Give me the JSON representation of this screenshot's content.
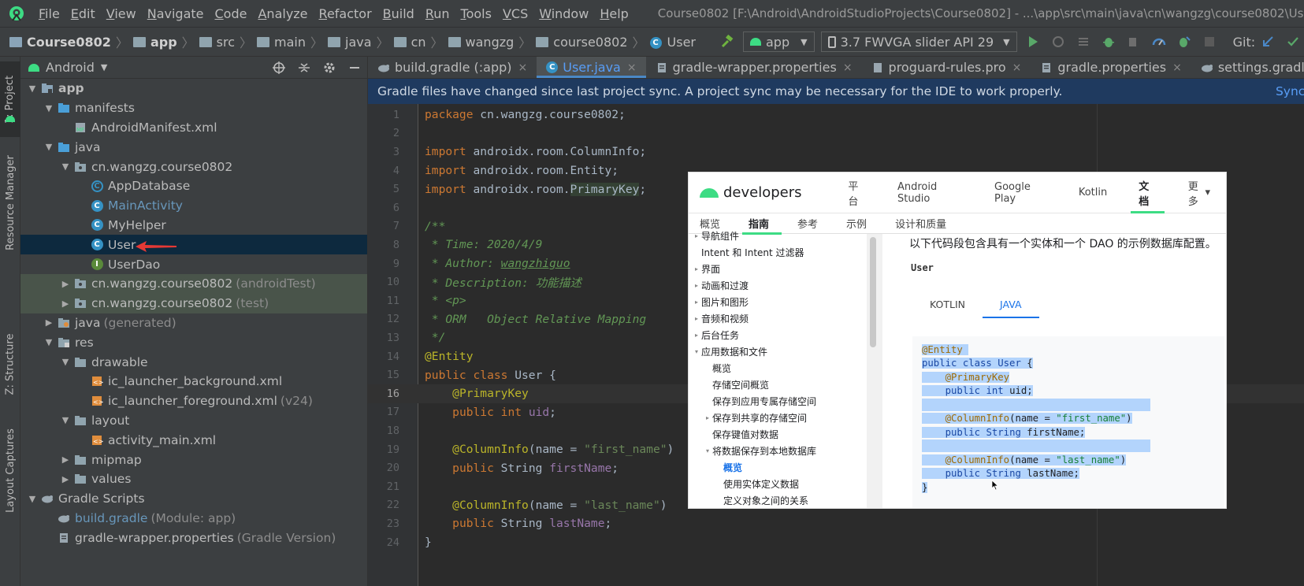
{
  "menu": {
    "items": [
      "File",
      "Edit",
      "View",
      "Navigate",
      "Code",
      "Analyze",
      "Refactor",
      "Build",
      "Run",
      "Tools",
      "VCS",
      "Window",
      "Help"
    ],
    "window_title": "Course0802 [F:\\Android\\AndroidStudioProjects\\Course0802] - ...\\app\\src\\main\\java\\cn\\wangzg\\course0802\\User.java"
  },
  "breadcrumb": [
    "Course0802",
    "app",
    "src",
    "main",
    "java",
    "cn",
    "wangzg",
    "course0802",
    "User"
  ],
  "toolbar": {
    "run_config": "app",
    "device": "3.7  FWVGA slider API 29",
    "git_label": "Git:"
  },
  "project_panel": {
    "view_mode": "Android",
    "tree": [
      {
        "label": "app",
        "depth": 0,
        "arrow": "▼",
        "icon": "module",
        "bold": true
      },
      {
        "label": "manifests",
        "depth": 1,
        "arrow": "▼",
        "icon": "folder-blue"
      },
      {
        "label": "AndroidManifest.xml",
        "depth": 2,
        "arrow": "",
        "icon": "manifest"
      },
      {
        "label": "java",
        "depth": 1,
        "arrow": "▼",
        "icon": "folder-blue"
      },
      {
        "label": "cn.wangzg.course0802",
        "depth": 2,
        "arrow": "▼",
        "icon": "package"
      },
      {
        "label": "AppDatabase",
        "depth": 3,
        "arrow": "",
        "icon": "class-abstract"
      },
      {
        "label": "MainActivity",
        "depth": 3,
        "arrow": "",
        "icon": "class",
        "blue": true
      },
      {
        "label": "MyHelper",
        "depth": 3,
        "arrow": "",
        "icon": "class"
      },
      {
        "label": "User",
        "depth": 3,
        "arrow": "",
        "icon": "class",
        "selected": true
      },
      {
        "label": "UserDao",
        "depth": 3,
        "arrow": "",
        "icon": "interface"
      },
      {
        "label": "cn.wangzg.course0802",
        "comment": "(androidTest)",
        "depth": 2,
        "arrow": "▶",
        "icon": "package",
        "test": true
      },
      {
        "label": "cn.wangzg.course0802",
        "comment": "(test)",
        "depth": 2,
        "arrow": "▶",
        "icon": "package",
        "test": true
      },
      {
        "label": "java",
        "comment": "(generated)",
        "depth": 1,
        "arrow": "▶",
        "icon": "folder-gen"
      },
      {
        "label": "res",
        "depth": 1,
        "arrow": "▼",
        "icon": "folder-res"
      },
      {
        "label": "drawable",
        "depth": 2,
        "arrow": "▼",
        "icon": "folder"
      },
      {
        "label": "ic_launcher_background.xml",
        "depth": 3,
        "arrow": "",
        "icon": "xml"
      },
      {
        "label": "ic_launcher_foreground.xml",
        "comment": "(v24)",
        "depth": 3,
        "arrow": "",
        "icon": "xml"
      },
      {
        "label": "layout",
        "depth": 2,
        "arrow": "▼",
        "icon": "folder"
      },
      {
        "label": "activity_main.xml",
        "depth": 3,
        "arrow": "",
        "icon": "xml"
      },
      {
        "label": "mipmap",
        "depth": 2,
        "arrow": "▶",
        "icon": "folder"
      },
      {
        "label": "values",
        "depth": 2,
        "arrow": "▶",
        "icon": "folder"
      },
      {
        "label": "Gradle Scripts",
        "depth": 0,
        "arrow": "▼",
        "icon": "gradle"
      },
      {
        "label": "build.gradle",
        "comment": "(Module: app)",
        "depth": 1,
        "arrow": "",
        "icon": "gradle",
        "blue": true
      },
      {
        "label": "gradle-wrapper.properties",
        "comment": "(Gradle Version)",
        "depth": 1,
        "arrow": "",
        "icon": "props"
      }
    ]
  },
  "side_tabs": [
    "1: Project",
    "Resource Manager",
    "Z: Structure",
    "Layout Captures"
  ],
  "editor_tabs": [
    {
      "label": "build.gradle (:app)",
      "icon": "gradle"
    },
    {
      "label": "User.java",
      "icon": "class",
      "active": true
    },
    {
      "label": "gradle-wrapper.properties",
      "icon": "props"
    },
    {
      "label": "proguard-rules.pro",
      "icon": "file"
    },
    {
      "label": "gradle.properties",
      "icon": "props"
    },
    {
      "label": "settings.gradle",
      "icon": "gradle"
    }
  ],
  "banner": {
    "message": "Gradle files have changed since last project sync. A project sync may be necessary for the IDE to work properly.",
    "action": "Sync Now"
  },
  "code_lines": [
    {
      "n": "1",
      "html": "<span class='kw'>package </span>cn.wangzg.course0802;"
    },
    {
      "n": "2",
      "html": ""
    },
    {
      "n": "3",
      "html": "<span class='kw'>import </span>androidx.room.ColumnInfo;"
    },
    {
      "n": "4",
      "html": "<span class='kw'>import </span>androidx.room.Entity;"
    },
    {
      "n": "5",
      "html": "<span class='kw'>import </span>androidx.room.<span class='hl'>PrimaryKey</span>;"
    },
    {
      "n": "6",
      "html": ""
    },
    {
      "n": "7",
      "html": "<span class='cm'>/**</span>"
    },
    {
      "n": "8",
      "html": "<span class='cm'> * Time: 2020/4/9</span>"
    },
    {
      "n": "9",
      "html": "<span class='cm'> * Author: <u>wangzhiguo</u></span>"
    },
    {
      "n": "10",
      "html": "<span class='cm'> * Description: 功能描述</span>"
    },
    {
      "n": "11",
      "html": "<span class='cm'> * &lt;p&gt;</span>"
    },
    {
      "n": "12",
      "html": "<span class='cm'> * ORM   Object Relative Mapping</span>"
    },
    {
      "n": "13",
      "html": "<span class='cm'> */</span>"
    },
    {
      "n": "14",
      "html": "<span class='an'>@Entity</span>"
    },
    {
      "n": "15",
      "html": "<span class='kw'>public class </span>User {"
    },
    {
      "n": "16",
      "html": "    <span class='an'>@PrimaryKey</span>",
      "current": true
    },
    {
      "n": "17",
      "html": "    <span class='kw'>public int </span><span class='fld'>uid</span>;"
    },
    {
      "n": "18",
      "html": ""
    },
    {
      "n": "19",
      "html": "    <span class='an'>@ColumnInfo</span>(name = <span class='st'>\"first_name\"</span>)"
    },
    {
      "n": "20",
      "html": "    <span class='kw'>public </span>String <span class='fld'>firstName</span>;"
    },
    {
      "n": "21",
      "html": ""
    },
    {
      "n": "22",
      "html": "    <span class='an'>@ColumnInfo</span>(name = <span class='st'>\"last_name\"</span>)"
    },
    {
      "n": "23",
      "html": "    <span class='kw'>public </span>String <span class='fld'>lastName</span>;"
    },
    {
      "n": "24",
      "html": "}"
    }
  ],
  "overlay": {
    "brand": "developers",
    "top_nav": [
      "平台",
      "Android Studio",
      "Google Play",
      "Kotlin",
      "文档",
      "更多"
    ],
    "active_top": "文档",
    "sub_nav": [
      "概览",
      "指南",
      "参考",
      "示例",
      "设计和质量"
    ],
    "active_sub": "指南",
    "sidebar": [
      {
        "label": "导航组件",
        "caret": "▸",
        "indent": 0
      },
      {
        "label": "Intent 和 Intent 过滤器",
        "caret": "",
        "indent": 0
      },
      {
        "label": "界面",
        "caret": "▸",
        "indent": 0
      },
      {
        "label": "动画和过渡",
        "caret": "▸",
        "indent": 0
      },
      {
        "label": "图片和图形",
        "caret": "▸",
        "indent": 0
      },
      {
        "label": "音频和视频",
        "caret": "▸",
        "indent": 0
      },
      {
        "label": "后台任务",
        "caret": "▸",
        "indent": 0
      },
      {
        "label": "应用数据和文件",
        "caret": "▾",
        "indent": 0
      },
      {
        "label": "概览",
        "caret": "",
        "indent": 1
      },
      {
        "label": "存储空间概览",
        "caret": "",
        "indent": 1
      },
      {
        "label": "保存到应用专属存储空间",
        "caret": "",
        "indent": 1
      },
      {
        "label": "保存到共享的存储空间",
        "caret": "▸",
        "indent": 1
      },
      {
        "label": "保存键值对数据",
        "caret": "",
        "indent": 1
      },
      {
        "label": "将数据保存到本地数据库",
        "caret": "▾",
        "indent": 1
      },
      {
        "label": "概览",
        "caret": "",
        "indent": 2,
        "active": true
      },
      {
        "label": "使用实体定义数据",
        "caret": "",
        "indent": 2
      },
      {
        "label": "定义对象之间的关系",
        "caret": "",
        "indent": 2
      }
    ],
    "intro": "以下代码段包含具有一个实体和一个 DAO 的示例数据库配置。",
    "code_label": "User",
    "code_tabs": [
      "KOTLIN",
      "JAVA"
    ],
    "active_code_tab": "JAVA",
    "code": [
      "<span class='pan'>@Entity</span> ",
      "<span class='pkw'>public class</span> <span class='pkw'>User</span> {",
      "    <span class='pan'>@PrimaryKey</span>",
      "    <span class='pkw'>public int</span> uid;",
      "",
      "    <span class='pan'>@ColumnInfo</span>(name = <span class='pst'>\"first_name\"</span>)",
      "    <span class='pkw'>public</span> <span class='pkw'>String</span> firstName;",
      "",
      "    <span class='pan'>@ColumnInfo</span>(name = <span class='pst'>\"last_name\"</span>)",
      "    <span class='pkw'>public</span> <span class='pkw'>String</span> lastName;",
      "}"
    ]
  }
}
